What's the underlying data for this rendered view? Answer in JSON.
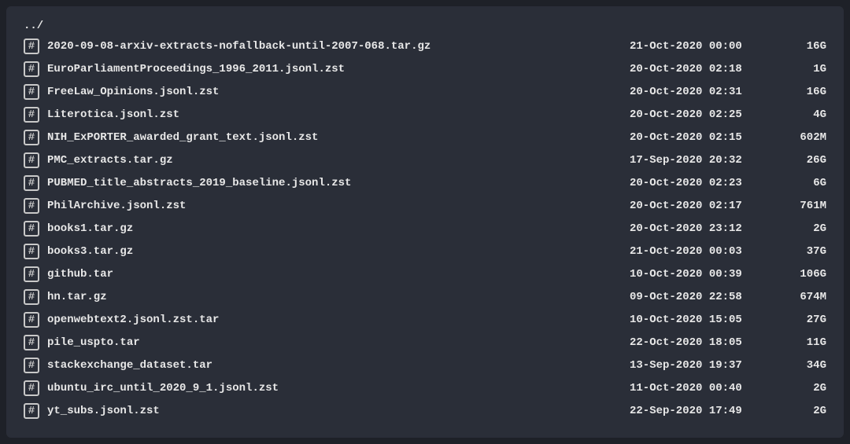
{
  "parent_label": "../",
  "icon_glyph": "#",
  "files": [
    {
      "name": "2020-09-08-arxiv-extracts-nofallback-until-2007-068.tar.gz",
      "date": "21-Oct-2020 00:00",
      "size": "16G"
    },
    {
      "name": "EuroParliamentProceedings_1996_2011.jsonl.zst",
      "date": "20-Oct-2020 02:18",
      "size": "1G"
    },
    {
      "name": "FreeLaw_Opinions.jsonl.zst",
      "date": "20-Oct-2020 02:31",
      "size": "16G"
    },
    {
      "name": "Literotica.jsonl.zst",
      "date": "20-Oct-2020 02:25",
      "size": "4G"
    },
    {
      "name": "NIH_ExPORTER_awarded_grant_text.jsonl.zst",
      "date": "20-Oct-2020 02:15",
      "size": "602M"
    },
    {
      "name": "PMC_extracts.tar.gz",
      "date": "17-Sep-2020 20:32",
      "size": "26G"
    },
    {
      "name": "PUBMED_title_abstracts_2019_baseline.jsonl.zst",
      "date": "20-Oct-2020 02:23",
      "size": "6G"
    },
    {
      "name": "PhilArchive.jsonl.zst",
      "date": "20-Oct-2020 02:17",
      "size": "761M"
    },
    {
      "name": "books1.tar.gz",
      "date": "20-Oct-2020 23:12",
      "size": "2G"
    },
    {
      "name": "books3.tar.gz",
      "date": "21-Oct-2020 00:03",
      "size": "37G"
    },
    {
      "name": "github.tar",
      "date": "10-Oct-2020 00:39",
      "size": "106G"
    },
    {
      "name": "hn.tar.gz",
      "date": "09-Oct-2020 22:58",
      "size": "674M"
    },
    {
      "name": "openwebtext2.jsonl.zst.tar",
      "date": "10-Oct-2020 15:05",
      "size": "27G"
    },
    {
      "name": "pile_uspto.tar",
      "date": "22-Oct-2020 18:05",
      "size": "11G"
    },
    {
      "name": "stackexchange_dataset.tar",
      "date": "13-Sep-2020 19:37",
      "size": "34G"
    },
    {
      "name": "ubuntu_irc_until_2020_9_1.jsonl.zst",
      "date": "11-Oct-2020 00:40",
      "size": "2G"
    },
    {
      "name": "yt_subs.jsonl.zst",
      "date": "22-Sep-2020 17:49",
      "size": "2G"
    }
  ]
}
